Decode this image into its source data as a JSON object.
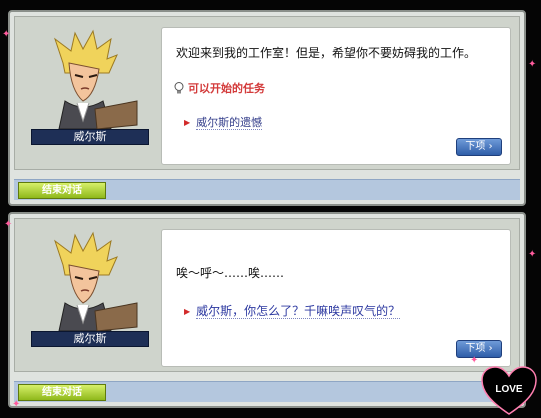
{
  "dialog1": {
    "npc_name": "威尔斯",
    "message": "欢迎来到我的工作室！但是，希望你不要妨碍我的工作。",
    "quest_header": "可以开始的任务",
    "option": "威尔斯的遗憾",
    "next_label": "下项",
    "end_label": "结束对话"
  },
  "dialog2": {
    "npc_name": "威尔斯",
    "message": "唉～呼～……唉……",
    "option": "威尔斯，你怎么了？千嘛唉声叹气的？",
    "next_label": "下项",
    "end_label": "结束对话"
  },
  "decor": {
    "love_text": "LOVE"
  },
  "colors": {
    "namebar": "#1e2f56",
    "quest_red": "#d33a3a",
    "option_blue": "#2c38a0",
    "end_button_green": "#a5c92d",
    "next_button_blue": "#2f5ea8"
  }
}
